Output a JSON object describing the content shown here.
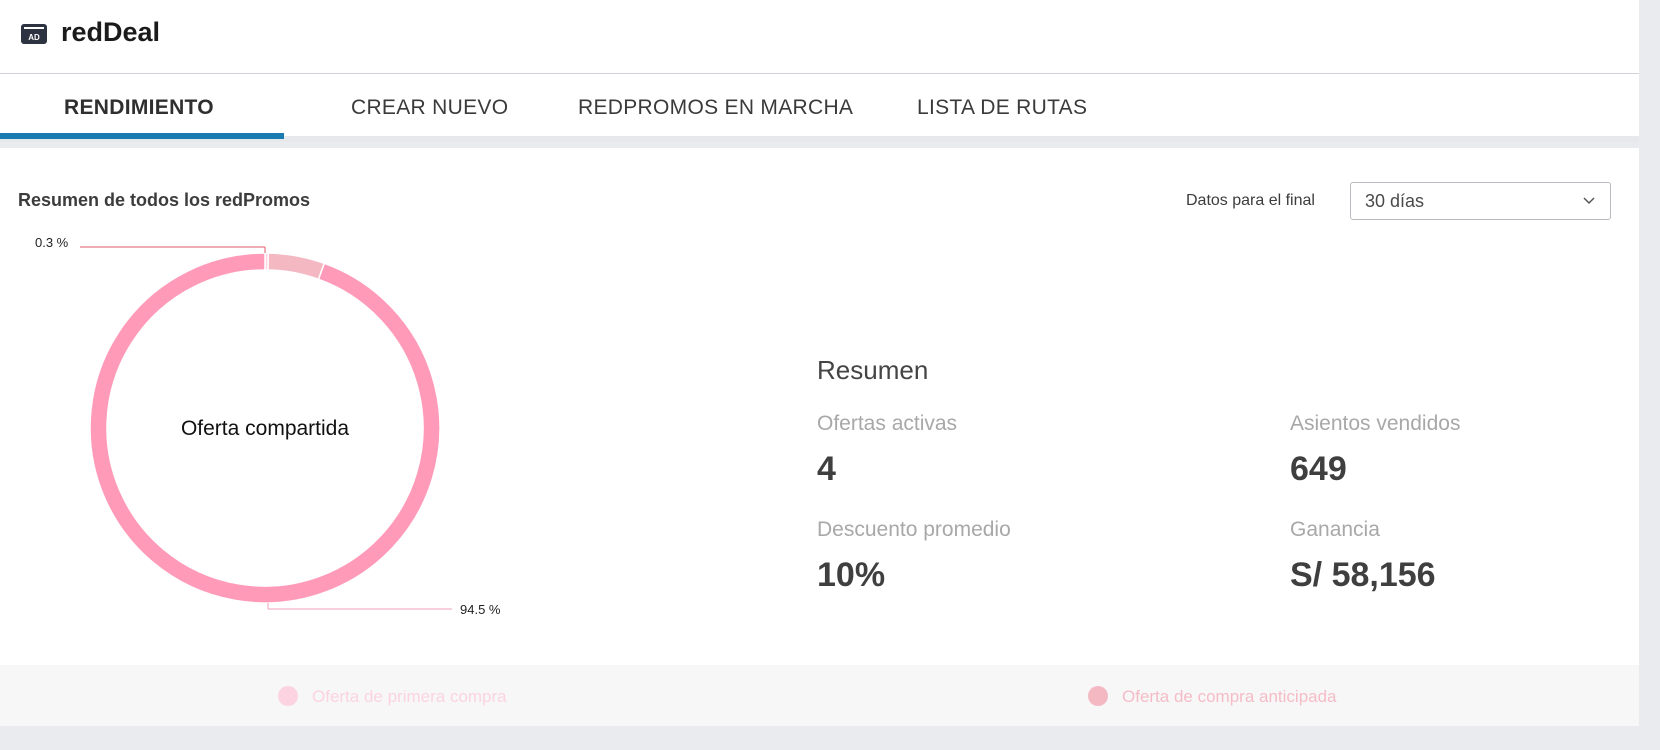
{
  "app": {
    "title": "redDeal",
    "logo_icon": "ad-window-icon",
    "logo_text": "AD"
  },
  "tabs": [
    {
      "label": "RENDIMIENTO",
      "active": true
    },
    {
      "label": "CREAR NUEVO",
      "active": false
    },
    {
      "label": "REDPROMOS EN MARCHA",
      "active": false
    },
    {
      "label": "LISTA DE RUTAS",
      "active": false
    }
  ],
  "panel": {
    "title": "Resumen de todos los redPromos",
    "range_label": "Datos para el final",
    "range_value": "30 días"
  },
  "chart_data": {
    "type": "pie",
    "center_label": "Oferta compartida",
    "slices": [
      {
        "name": "Oferta compartida",
        "percent": 94.5,
        "label": "94.5 %",
        "color": "#ff9bb8"
      },
      {
        "name": "Oferta de primera compra",
        "percent": 0.3,
        "label": "0.3 %",
        "color": "#fcd3e0"
      },
      {
        "name": "Oferta de compra anticipada",
        "percent": 5.2,
        "color": "#f4b8c3"
      }
    ],
    "legend_position": "bottom"
  },
  "summary": {
    "title": "Resumen",
    "stats": [
      {
        "label": "Ofertas activas",
        "value": "4"
      },
      {
        "label": "Asientos vendidos",
        "value": "649"
      },
      {
        "label": "Descuento promedio",
        "value": "10%"
      },
      {
        "label": "Ganancia",
        "value": "S/ 58,156"
      }
    ]
  },
  "legend": [
    {
      "label": "Oferta de primera compra",
      "dot_color": "#fcd3e0",
      "text_color": "#fbd4e0"
    },
    {
      "label": "Oferta de compra anticipada",
      "dot_color": "#f4b8c3",
      "text_color": "#f6bcc6"
    }
  ],
  "colors": {
    "accent": "#1a7bb0",
    "main_slice": "#ff9bb8"
  }
}
